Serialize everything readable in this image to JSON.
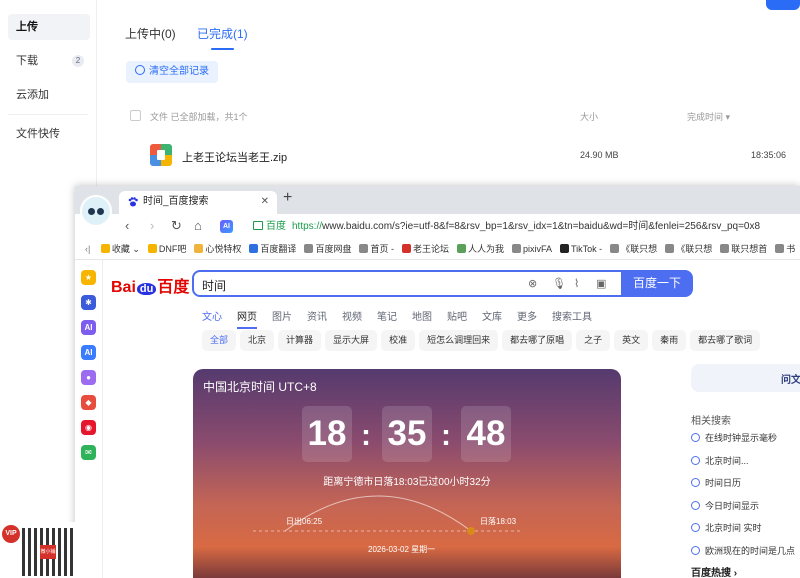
{
  "netdisk": {
    "sidebar": [
      {
        "label": "上传",
        "active": true
      },
      {
        "label": "下载",
        "badge": "2"
      },
      {
        "label": "云添加"
      },
      {
        "label": "文件快传"
      }
    ],
    "tabs": [
      {
        "label": "上传中(0)",
        "active": false
      },
      {
        "label": "已完成(1)",
        "active": true
      }
    ],
    "clear_button": "清空全部记录",
    "list_header": {
      "file": "文件  已全部加载，共1个",
      "size": "大小",
      "time": "完成时间 ▾"
    },
    "files": [
      {
        "name": "上老王论坛当老王.zip",
        "size": "24.90 MB",
        "time": "18:35:06"
      }
    ]
  },
  "browser": {
    "tab_title": "时间_百度搜索",
    "tab_close": "✕",
    "new_tab": "+",
    "ai_chip": "AI",
    "address": {
      "site": "百度",
      "https": "https://",
      "rest": "www.baidu.com/s?ie=utf-8&f=8&rsv_bp=1&rsv_idx=1&tn=baidu&wd=时间&fenlei=256&rsv_pq=0x8"
    },
    "bookmarks": [
      "收藏 ⌄",
      "DNF吧",
      "心悦特权",
      "百度翻译",
      "百度网盘",
      "首页 -",
      "老王论坛",
      "人人为我",
      "pixivFA",
      "TikTok -",
      "《联只想",
      "《联只想",
      "联只想首",
      "书"
    ],
    "bookmark_colors": [
      "#f5b400",
      "#f5b400",
      "#f0b43c",
      "#2f6fde",
      "#888888",
      "#888888",
      "#d3312a",
      "#5aa05a",
      "#888888",
      "#222222",
      "#888888",
      "#888888",
      "#888888",
      "#888888"
    ],
    "left_icons": [
      {
        "name": "star-icon",
        "color": "#f7b500",
        "text": "★"
      },
      {
        "name": "network-icon",
        "color": "#3b5bdb",
        "text": "✱"
      },
      {
        "name": "ai-circle-icon",
        "color": "#7d5cf0",
        "text": "AI"
      },
      {
        "name": "ai-square-icon",
        "color": "#3a7bff",
        "text": "AI"
      },
      {
        "name": "planet-icon",
        "color": "#9b6cf0",
        "text": "●"
      },
      {
        "name": "gamepad-icon",
        "color": "#e84c3d",
        "text": "◆"
      },
      {
        "name": "weibo-icon",
        "color": "#e6162d",
        "text": "◉"
      },
      {
        "name": "mail-icon",
        "color": "#2fb35a",
        "text": "✉"
      }
    ]
  },
  "baidu": {
    "logo_bai": "Bai",
    "logo_du": "du",
    "logo_cn": "百度",
    "query": "时间",
    "search_button": "百度一下",
    "tabs": [
      "文心",
      "网页",
      "图片",
      "资讯",
      "视频",
      "笔记",
      "地图",
      "贴吧",
      "文库",
      "更多",
      "搜索工具"
    ],
    "chips": [
      "全部",
      "北京",
      "计算器",
      "显示大屏",
      "校准",
      "短怎么调理回来",
      "都去哪了原唱",
      "之子",
      "英文",
      "秦雨",
      "都去哪了歌词"
    ],
    "clock": {
      "title": "中国北京时间 UTC+8",
      "hours": "18",
      "minutes": "35",
      "seconds": "48",
      "sunset_note": "距离宁德市日落18:03已过00小时32分",
      "sunrise": "日出06:25",
      "sunset": "日落18:03",
      "date": "2026-03-02  星期一"
    },
    "right_button": "问文",
    "related_title": "相关搜索",
    "related": [
      "在线时钟显示毫秒",
      "北京时间...",
      "时间日历",
      "今日时间显示",
      "北京时间 实时",
      "欧洲现在的时间是几点"
    ],
    "hot_title": "百度热搜  ›"
  },
  "ad": {
    "vip": "VIP",
    "qr_label": "微小铺"
  },
  "colors": {
    "accent": "#2b6cf6",
    "baidu_blue": "#4e6ef2",
    "baidu_red": "#e10602"
  }
}
